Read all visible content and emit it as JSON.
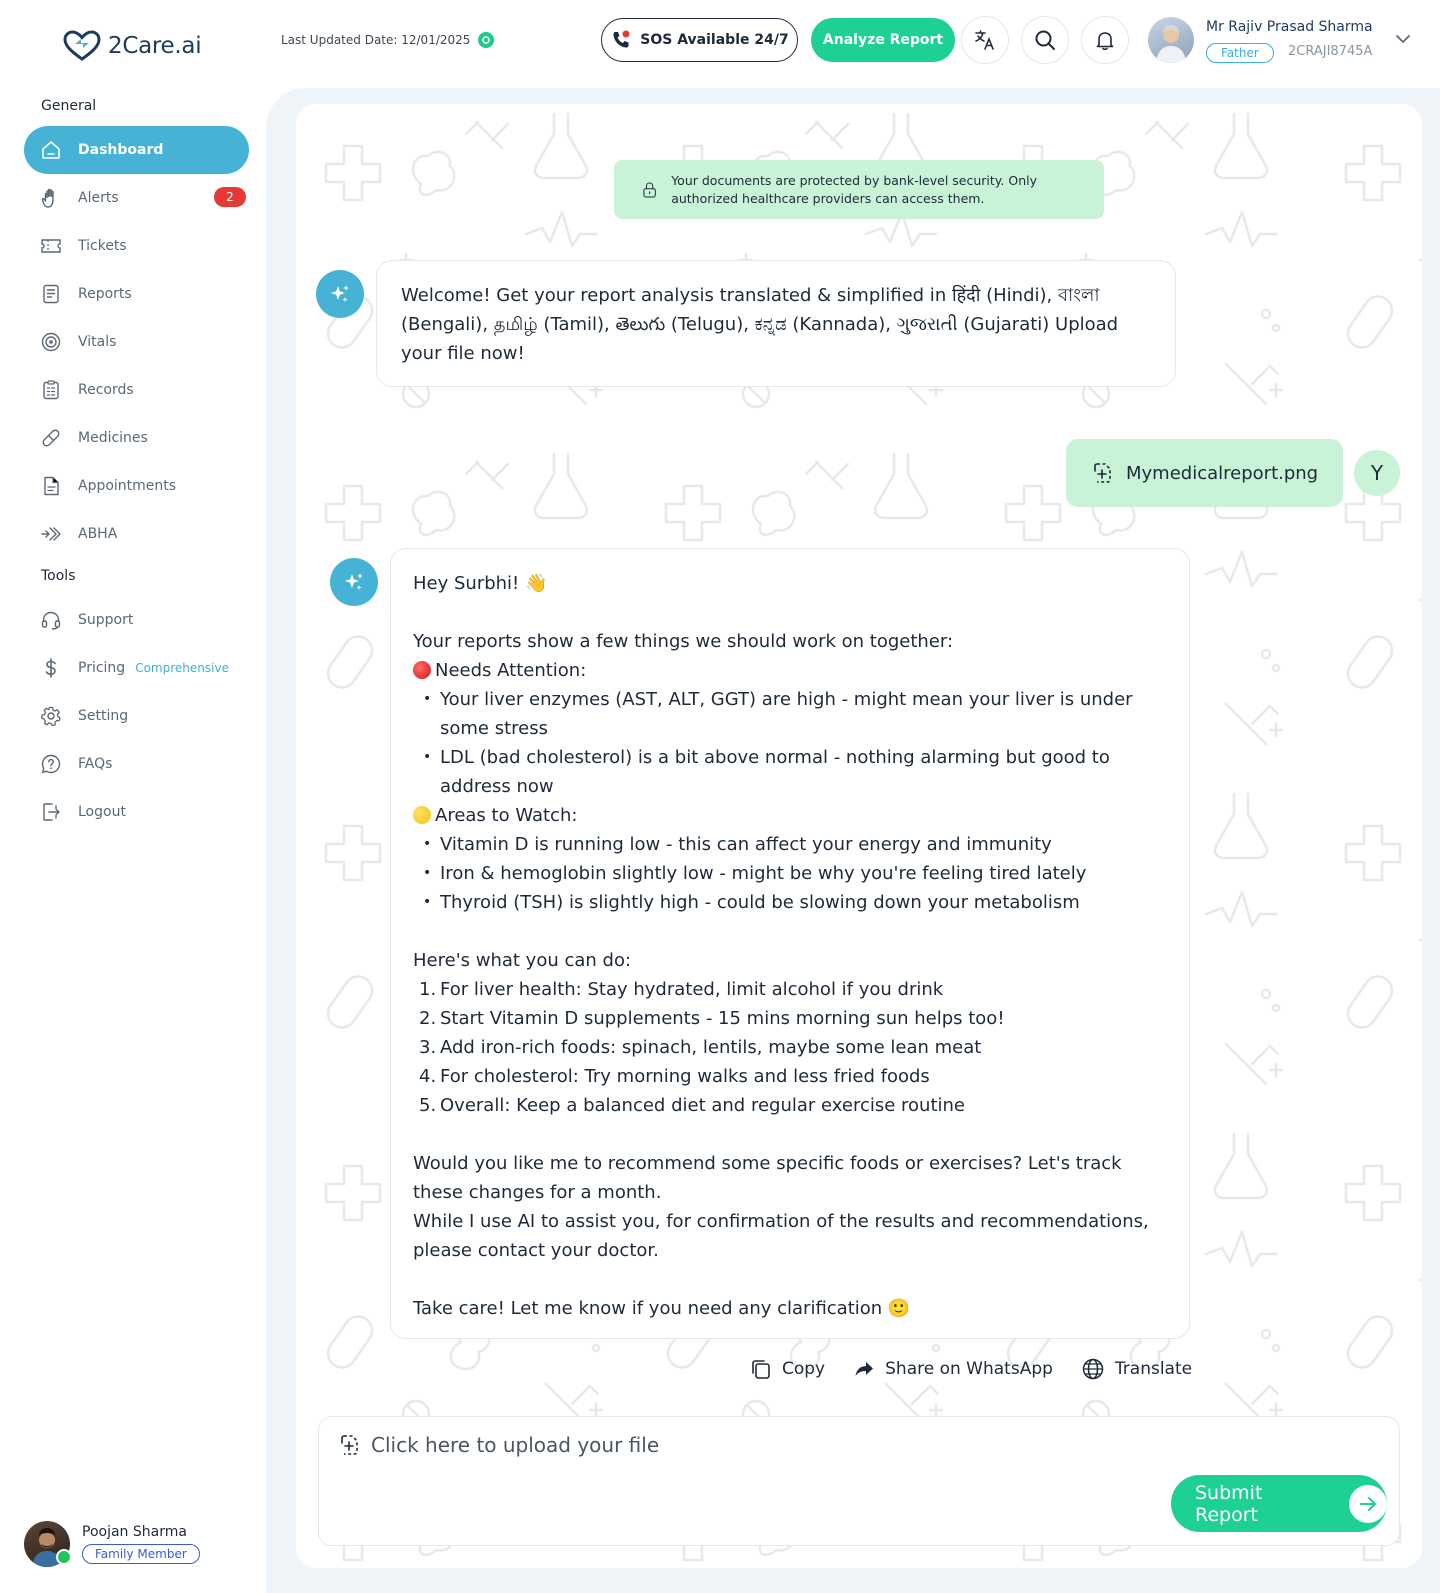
{
  "app": {
    "name": "2Care.ai"
  },
  "header": {
    "last_updated": "Last Updated Date: 12/01/2025",
    "sos_label": "SOS Available 24/7",
    "analyze_label": "Analyze Report",
    "user": {
      "name": "Mr Rajiv Prasad Sharma",
      "role": "Father",
      "id": "2CRAJI8745A"
    }
  },
  "sidebar": {
    "general_label": "General",
    "tools_label": "Tools",
    "items": [
      {
        "label": "Dashboard",
        "icon": "home-icon"
      },
      {
        "label": "Alerts",
        "icon": "hand-icon",
        "badge": "2"
      },
      {
        "label": "Tickets",
        "icon": "ticket-icon"
      },
      {
        "label": "Reports",
        "icon": "report-icon"
      },
      {
        "label": "Vitals",
        "icon": "vitals-icon"
      },
      {
        "label": "Records",
        "icon": "records-icon"
      },
      {
        "label": "Medicines",
        "icon": "pill-icon"
      },
      {
        "label": "Appointments",
        "icon": "appointment-icon"
      },
      {
        "label": "ABHA",
        "icon": "abha-icon"
      }
    ],
    "tools": [
      {
        "label": "Support",
        "icon": "headset-icon"
      },
      {
        "label": "Pricing",
        "icon": "dollar-icon",
        "tag": "Comprehensive"
      },
      {
        "label": "Setting",
        "icon": "gear-icon"
      },
      {
        "label": "FAQs",
        "icon": "question-icon"
      },
      {
        "label": "Logout",
        "icon": "logout-icon"
      }
    ],
    "profile": {
      "name": "Poojan Sharma",
      "role": "Family Member"
    }
  },
  "chat": {
    "security_note": "Your documents are protected by bank-level security. Only authorized healthcare providers can access them.",
    "welcome": "Welcome! Get your report analysis translated & simplified in हिंदी (Hindi), বাংলা (Bengali), தமிழ் (Tamil), తెలుగు (Telugu), ಕನ್ನಡ (Kannada), ગુજરાતી (Gujarati) Upload your file now!",
    "file_name": "Mymedicalreport.png",
    "user_initial": "Y",
    "reply": {
      "greeting": "Hey Surbhi! 👋",
      "intro": "Your reports show a few things we should work on together:",
      "attention_label": "Needs Attention:",
      "attention_items": [
        "Your liver enzymes (AST, ALT, GGT) are high - might mean your liver is under some stress",
        "LDL (bad cholesterol) is a bit above normal - nothing alarming but good to address now"
      ],
      "watch_label": "Areas to Watch:",
      "watch_items": [
        "Vitamin D is running low - this can affect your energy and immunity",
        "Iron & hemoglobin slightly low - might be why you're feeling tired lately",
        "Thyroid (TSH) is slightly high - could be slowing down your metabolism"
      ],
      "todo_label": "Here's what you can do:",
      "todo_items": [
        {
          "num": "1.",
          "text": "For liver health: Stay hydrated, limit alcohol if you drink"
        },
        {
          "num": "2.",
          "text": "Start Vitamin D supplements - 15 mins morning sun helps too!"
        },
        {
          "num": "3.",
          "text": "Add iron-rich foods: spinach, lentils, maybe some lean meat"
        },
        {
          "num": "4.",
          "text": "For cholesterol: Try morning walks and less fried foods"
        },
        {
          "num": "5.",
          "text": "Overall: Keep a balanced diet and regular exercise routine"
        }
      ],
      "followup": "Would you like me to recommend some specific foods or exercises? Let's track these changes for a month.",
      "disclaimer": "While I use AI to assist you, for confirmation of the results and recommendations, please contact your doctor.",
      "closing": "Take care! Let me know if you need any clarification 🙂"
    },
    "actions": {
      "copy": "Copy",
      "share": "Share on WhatsApp",
      "translate": "Translate"
    },
    "upload_hint": "Click here to upload your file",
    "submit_label": "Submit Report"
  },
  "colors": {
    "accent": "#46b3d6",
    "primary_green": "#1ed093",
    "soft_green": "#c8f3d6",
    "alert_red": "#e53935"
  }
}
